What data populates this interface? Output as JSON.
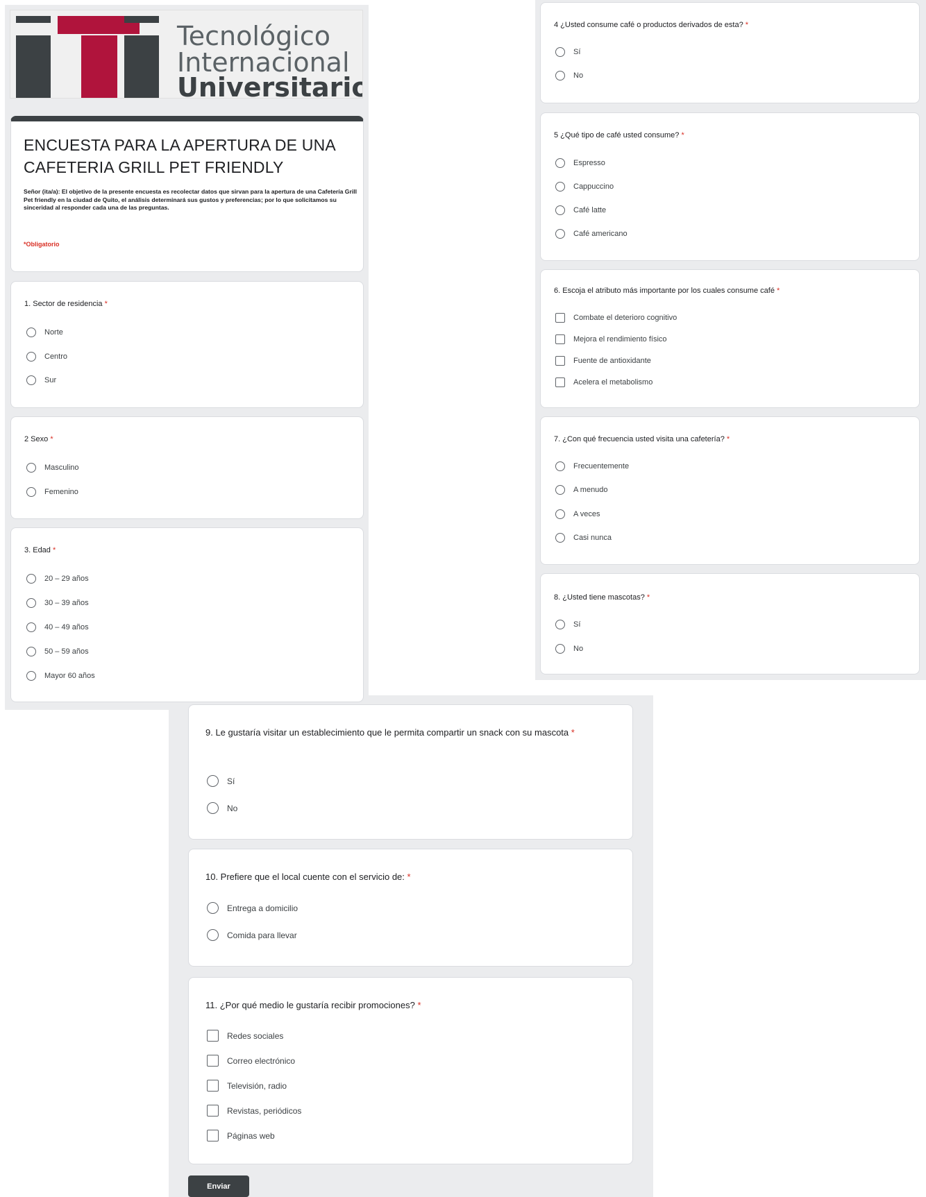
{
  "logo": {
    "line1": "Tecnológico",
    "line2": "Internacional",
    "line3": "Universitario",
    "mark_colors": [
      "#3c4144",
      "#b0143c",
      "#3c4144"
    ]
  },
  "form": {
    "title": "ENCUESTA PARA LA APERTURA DE UNA CAFETERIA GRILL PET FRIENDLY",
    "description": "Señor (ita/a): El objetivo de la presente encuesta es recolectar datos que sirvan para la apertura de una Cafetería Grill Pet friendly en la ciudad de Quito, el análisis determinará sus gustos y preferencias; por lo que solicitamos su sinceridad al responder cada una de las preguntas.",
    "required_note": "*Obligatorio",
    "required_marker": "*",
    "submit_label": "Enviar",
    "accent_color": "#3c4144",
    "required_color": "#d93025"
  },
  "questions": [
    {
      "title": "1. Sector de residencia",
      "options": [
        "Norte",
        "Centro",
        "Sur"
      ]
    },
    {
      "title": "2 Sexo",
      "options": [
        "Masculino",
        "Femenino"
      ]
    },
    {
      "title": "3. Edad",
      "options": [
        "20 – 29 años",
        "30 – 39 años",
        "40 – 49 años",
        "50 – 59 años",
        "Mayor 60 años"
      ]
    },
    {
      "title": "4 ¿Usted consume café o productos derivados de esta?",
      "options": [
        "Sí",
        "No"
      ]
    },
    {
      "title": "5 ¿Qué tipo de café usted consume?",
      "options": [
        "Espresso",
        "Cappuccino",
        "Café latte",
        "Café americano"
      ]
    },
    {
      "title": "6. Escoja el atributo más importante por los cuales consume café",
      "options": [
        "Combate el deterioro cognitivo",
        "Mejora el rendimiento físico",
        "Fuente de antioxidante",
        "Acelera el metabolismo"
      ]
    },
    {
      "title": "7. ¿Con qué frecuencia usted visita una cafetería?",
      "options": [
        "Frecuentemente",
        "A menudo",
        "A veces",
        "Casi nunca"
      ]
    },
    {
      "title": "8. ¿Usted tiene mascotas?",
      "options": [
        "Sí",
        "No"
      ]
    },
    {
      "title": "9. Le gustaría visitar un establecimiento que le permita compartir un snack con su mascota",
      "options": [
        "Sí",
        "No"
      ]
    },
    {
      "title": "10. Prefiere que el local cuente con el servicio de:",
      "options": [
        "Entrega a domicilio",
        "Comida para llevar"
      ]
    },
    {
      "title": "11. ¿Por qué medio le gustaría recibir promociones?",
      "options": [
        "Redes sociales",
        "Correo electrónico",
        "Televisión, radio",
        "Revistas, periódicos",
        "Páginas web"
      ]
    }
  ]
}
